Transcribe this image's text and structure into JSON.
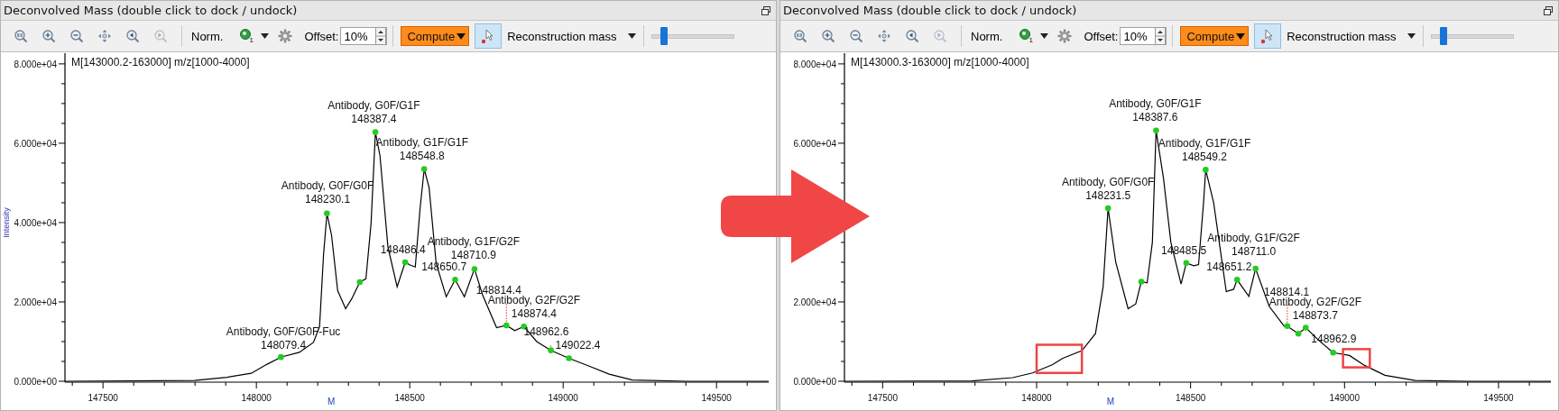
{
  "panels": [
    {
      "title": "Deconvolved Mass (double click to dock / undock)",
      "toolbar": [
        {
          "kind": "fit",
          "disabled": false
        },
        {
          "kind": "zoomin",
          "disabled": false
        },
        {
          "kind": "zoomout",
          "disabled": false
        },
        {
          "kind": "pan",
          "disabled": false
        },
        {
          "kind": "back",
          "disabled": false
        },
        {
          "kind": "forward",
          "disabled": true
        },
        {
          "kind": "separator"
        },
        {
          "kind": "text-button",
          "label": "Norm."
        },
        {
          "kind": "menu-icon",
          "badge": "1"
        },
        {
          "kind": "gear",
          "disabled": false
        },
        {
          "kind": "spin",
          "label": "Offset:",
          "value": "10%"
        },
        {
          "kind": "separator"
        },
        {
          "kind": "menu-button",
          "label": "Compute"
        },
        {
          "kind": "toggle",
          "checked": true
        },
        {
          "kind": "dropdown",
          "value": "Reconstruction mass"
        },
        {
          "kind": "separator"
        },
        {
          "kind": "slider",
          "level": 0.15
        }
      ],
      "chart": {
        "title": "M[143000.2-163000] m/z[1000-4000]",
        "marker_label": "M",
        "chart_data": {
          "type": "line",
          "ylabel": "Intensity",
          "xlim": [
            147376,
            149670
          ],
          "ylim": [
            0,
            82700
          ],
          "xticks": [
            147500,
            148000,
            148500,
            149000,
            149500
          ],
          "yticks": [
            {
              "value": 0,
              "label": "0.000e+00"
            },
            {
              "value": 20000,
              "label": "2.000e+04"
            },
            {
              "value": 40000,
              "label": "4.000e+04"
            },
            {
              "value": 60000,
              "label": "6.000e+04"
            },
            {
              "value": 80000,
              "label": "8.000e+04"
            }
          ],
          "x": [
            147376,
            147799,
            147904,
            147983,
            148035,
            148080,
            148140,
            148186,
            148206,
            148219,
            148230,
            148245,
            148265,
            148291,
            148311,
            148337,
            148357,
            148374,
            148388,
            148403,
            148429,
            148459,
            148485,
            148501,
            148518,
            148534,
            148547,
            148563,
            148586,
            148619,
            148648,
            148678,
            148711,
            148737,
            148783,
            148815,
            148842,
            148872,
            148914,
            148960,
            149019,
            149085,
            149150,
            149226,
            149400,
            149670
          ],
          "series": [
            {
              "color": "#000000",
              "values": [
                0,
                200,
                1000,
                2000,
                4300,
                6100,
                7300,
                9800,
                13800,
                31800,
                42300,
                36800,
                22800,
                18300,
                20800,
                25000,
                25800,
                39800,
                62800,
                56800,
                33800,
                23800,
                30000,
                29300,
                28800,
                43800,
                53500,
                48800,
                29800,
                21300,
                25600,
                21300,
                28300,
                21800,
                13500,
                14100,
                12800,
                13800,
                10000,
                7800,
                5800,
                3800,
                1800,
                300,
                0,
                0
              ]
            }
          ]
        },
        "peaks": [
          {
            "kind": "labeled",
            "label": "Antibody, G0F/G0F-Fuc",
            "mass": "148079.4"
          },
          {
            "kind": "labeled",
            "label": "Antibody, G0F/G0F",
            "mass": "148230.1"
          },
          {
            "kind": "dot"
          },
          {
            "kind": "labeled",
            "label": "Antibody, G0F/G1F",
            "mass": "148387.4"
          },
          {
            "kind": "labeled",
            "label": "Antibody, G1F/G1F",
            "mass": "148548.8"
          },
          {
            "kind": "mass",
            "mass": "148486.4"
          },
          {
            "kind": "labeled",
            "label": "Antibody, G1F/G2F",
            "mass": "148710.9"
          },
          {
            "kind": "mass",
            "mass": "148650.7"
          },
          {
            "kind": "mass",
            "mass": "148814.4"
          },
          {
            "kind": "labeled",
            "label": "Antibody, G2F/G2F",
            "mass": "148874.4"
          },
          {
            "kind": "mass",
            "mass": "148962.6"
          },
          {
            "kind": "mass",
            "mass": "149022.4"
          }
        ]
      }
    },
    {
      "title": "Deconvolved Mass (double click to dock / undock)",
      "toolbar": [
        {
          "kind": "fit",
          "disabled": false
        },
        {
          "kind": "zoomin",
          "disabled": false
        },
        {
          "kind": "zoomout",
          "disabled": false
        },
        {
          "kind": "pan",
          "disabled": false
        },
        {
          "kind": "back",
          "disabled": false
        },
        {
          "kind": "forward",
          "disabled": true
        },
        {
          "kind": "separator"
        },
        {
          "kind": "text-button",
          "label": "Norm."
        },
        {
          "kind": "menu-icon",
          "badge": "1"
        },
        {
          "kind": "gear",
          "disabled": false
        },
        {
          "kind": "spin",
          "label": "Offset:",
          "value": "10%"
        },
        {
          "kind": "separator"
        },
        {
          "kind": "menu-button",
          "label": "Compute"
        },
        {
          "kind": "toggle",
          "checked": true
        },
        {
          "kind": "dropdown",
          "value": "Reconstruction mass"
        },
        {
          "kind": "separator"
        },
        {
          "kind": "slider",
          "level": 0.15
        }
      ],
      "chart": {
        "title": "M[143000.3-163000] m/z[1000-4000]",
        "marker_label": "M",
        "chart_data": {
          "type": "line",
          "xlim": [
            147376,
            149670
          ],
          "ylim": [
            0,
            82700
          ],
          "xticks": [
            147500,
            148000,
            148500,
            149000,
            149500
          ],
          "yticks": [
            {
              "value": 0,
              "label": "0.000e+00"
            },
            {
              "value": 20000,
              "label": "2.000e+04"
            },
            {
              "value": 60000,
              "label": "6.000e+04"
            },
            {
              "value": 80000,
              "label": "8.000e+04"
            }
          ],
          "x": [
            147376,
            147791,
            147922,
            147987,
            148052,
            148085,
            148147,
            148191,
            148216,
            148232,
            148257,
            148297,
            148322,
            148340,
            148359,
            148376,
            148388,
            148412,
            148436,
            148469,
            148486,
            148510,
            148526,
            148542,
            148549,
            148575,
            148616,
            148640,
            148651,
            148689,
            148711,
            148755,
            148804,
            148814,
            148850,
            148874,
            148918,
            148963,
            149016,
            149065,
            149131,
            149229,
            149400,
            149670
          ],
          "series": [
            {
              "color": "#000000",
              "values": [
                0,
                100,
                900,
                2100,
                4200,
                5800,
                7700,
                12000,
                23800,
                43600,
                30000,
                18300,
                19500,
                25100,
                24800,
                35000,
                63200,
                51200,
                35000,
                24500,
                29800,
                29100,
                29400,
                45000,
                53300,
                45000,
                22600,
                23200,
                25600,
                21400,
                28400,
                18900,
                13900,
                13900,
                12000,
                13500,
                10200,
                7200,
                6500,
                4000,
                1500,
                200,
                0,
                0
              ]
            }
          ]
        },
        "peaks": [
          {
            "kind": "labeled",
            "label": "Antibody, G0F/G0F",
            "mass": "148231.5"
          },
          {
            "kind": "dot"
          },
          {
            "kind": "labeled",
            "label": "Antibody, G0F/G1F",
            "mass": "148387.6"
          },
          {
            "kind": "labeled",
            "label": "Antibody, G1F/G1F",
            "mass": "148549.2"
          },
          {
            "kind": "mass",
            "mass": "148485.5"
          },
          {
            "kind": "labeled",
            "label": "Antibody, G1F/G2F",
            "mass": "148711.0"
          },
          {
            "kind": "mass",
            "mass": "148651.2"
          },
          {
            "kind": "mass",
            "mass": "148814.1"
          },
          {
            "kind": "dot"
          },
          {
            "kind": "labeled",
            "label": "Antibody, G2F/G2F",
            "mass": "148873.7"
          },
          {
            "kind": "mass",
            "mass": "148962.9"
          }
        ],
        "highlights": [
          {
            "kind": "box"
          },
          {
            "kind": "box"
          }
        ]
      }
    }
  ],
  "overlay": {
    "kind": "arrow"
  }
}
